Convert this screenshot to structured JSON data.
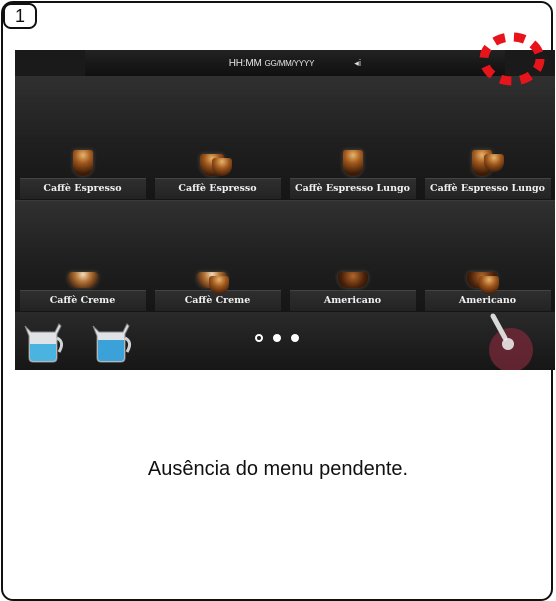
{
  "step_number": "1",
  "status_bar": {
    "time_format": "HH:MM",
    "date_format": "GG/MM/YYYY",
    "speaker_icon": "speaker-icon",
    "speaker_symbol": "◂ⅰ"
  },
  "drink_rows": [
    [
      {
        "label": "Caffè Espresso"
      },
      {
        "label": "Caffè Espresso"
      },
      {
        "label": "Caffè Espresso Lungo"
      },
      {
        "label": "Caffè Espresso Lungo"
      }
    ],
    [
      {
        "label": "Caffè Creme"
      },
      {
        "label": "Caffè Creme"
      },
      {
        "label": "Americano"
      },
      {
        "label": "Americano"
      }
    ]
  ],
  "pager": {
    "pages": 3,
    "current_page": 1
  },
  "caption": "Ausência do menu pendente.",
  "colors": {
    "highlight": "#e8141c",
    "screen_bg": "#1a1a1a",
    "milk_jug": "#4ab3e0"
  }
}
